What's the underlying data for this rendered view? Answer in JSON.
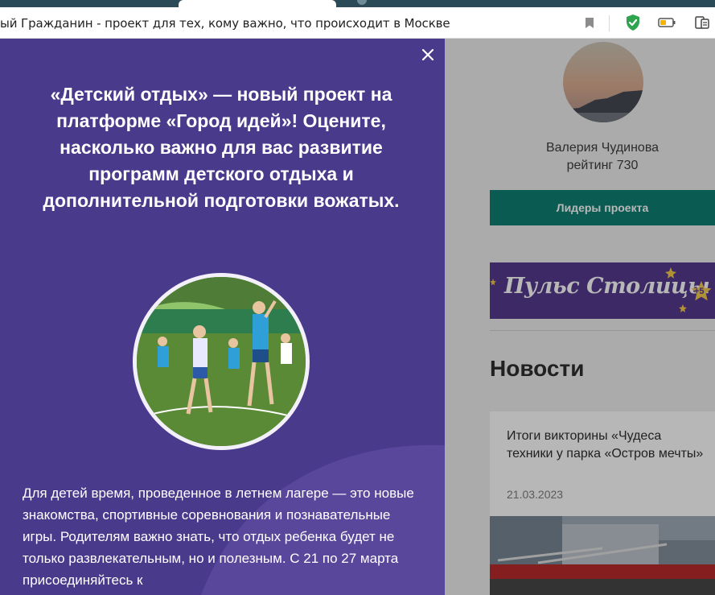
{
  "browser": {
    "url_title": "ый Гражданин - проект для тех, кому важно, что происходит в Москве",
    "icons": [
      "bookmark-icon",
      "shield-check-icon",
      "battery-icon",
      "side-panel-icon"
    ],
    "accent_colors": {
      "shield": "#2ea44f",
      "battery": "#f2b400"
    }
  },
  "sidebar": {
    "user_name": "Валерия Чудинова",
    "user_rating": "рейтинг 730",
    "leaders_button": "Лидеры проекта",
    "promo_logo": "Пульс Столицы",
    "promo_badge": "+5",
    "news_heading": "Новости",
    "news": [
      {
        "title": "Итоги викторины «Чудеса техники у парка «Остров мечты»",
        "date": "21.03.2023"
      }
    ]
  },
  "modal": {
    "title": "«Детский отдых» — новый проект на платформе «Город идей»! Оцените, насколько важно для вас развитие программ детского отдыха и дополнительной подготовки вожатых.",
    "body": "Для детей время, проведенное в летнем лагере — это новые знакомства, спортивные соревнования и познавательные игры. Родителям важно знать, что отдых ребенка будет не только развлекательным, но и полезным. С 21 по 27 марта присоединяйтесь к",
    "close_icon": "close-icon",
    "colors": {
      "background": "#4a3a8c",
      "leaders_button": "#00796b",
      "promo_banner": "#4b2f86"
    }
  }
}
